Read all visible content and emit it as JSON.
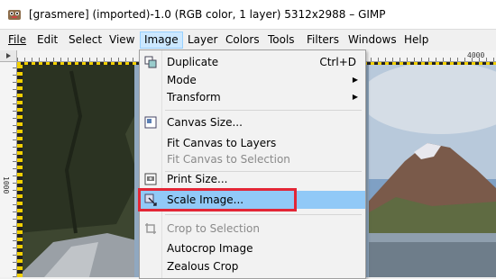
{
  "window": {
    "title": "[grasmere] (imported)-1.0 (RGB color, 1 layer) 5312x2988 – GIMP"
  },
  "menubar": {
    "items": [
      {
        "label": "File",
        "active": false
      },
      {
        "label": "Edit",
        "active": false
      },
      {
        "label": "Select",
        "active": false
      },
      {
        "label": "View",
        "active": false
      },
      {
        "label": "Image",
        "active": true
      },
      {
        "label": "Layer",
        "active": false
      },
      {
        "label": "Colors",
        "active": false
      },
      {
        "label": "Tools",
        "active": false
      },
      {
        "label": "Filters",
        "active": false
      },
      {
        "label": "Windows",
        "active": false
      },
      {
        "label": "Help",
        "active": false
      }
    ]
  },
  "rulers": {
    "horizontal_label": "4000",
    "vertical_label": "1000"
  },
  "image_menu": {
    "items": [
      {
        "label": "Duplicate",
        "accel": "Ctrl+D",
        "icon": "duplicate-icon"
      },
      {
        "label": "Mode",
        "submenu": true
      },
      {
        "label": "Transform",
        "submenu": true
      },
      {
        "label": "Canvas Size...",
        "icon": "canvas-size-icon"
      },
      {
        "label": "Fit Canvas to Layers"
      },
      {
        "label": "Fit Canvas to Selection",
        "disabled": true
      },
      {
        "label": "Print Size...",
        "icon": "print-size-icon"
      },
      {
        "label": "Scale Image...",
        "icon": "scale-image-icon",
        "highlighted": true
      },
      {
        "label": "Crop to Selection",
        "icon": "crop-icon",
        "disabled": true
      },
      {
        "label": "Autocrop Image"
      },
      {
        "label": "Zealous Crop"
      }
    ]
  },
  "colors": {
    "menu_highlight": "#91c9f7",
    "annotation_box": "#e32636",
    "active_menu": "#cce8ff"
  }
}
